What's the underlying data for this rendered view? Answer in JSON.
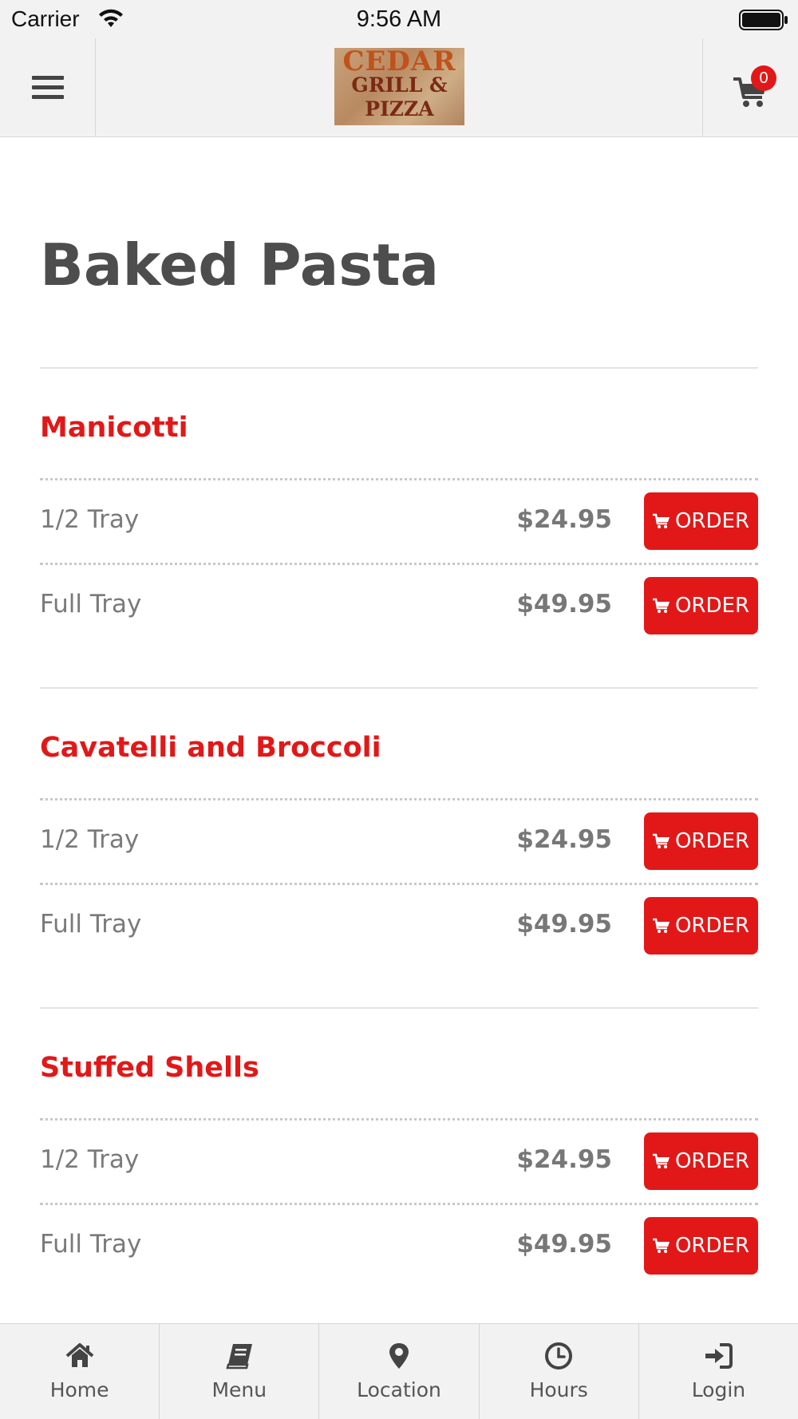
{
  "status_bar": {
    "carrier": "Carrier",
    "time": "9:56 AM"
  },
  "header": {
    "logo": {
      "line1": "CEDAR",
      "line2": "GRILL &",
      "line3": "PIZZA"
    },
    "cart_count": "0",
    "menu_icon": "hamburger-icon",
    "cart_icon": "shopping-cart-icon"
  },
  "page": {
    "title": "Baked Pasta"
  },
  "items": [
    {
      "name": "Manicotti",
      "options": [
        {
          "size": "1/2 Tray",
          "price": "$24.95",
          "button": "ORDER"
        },
        {
          "size": "Full Tray",
          "price": "$49.95",
          "button": "ORDER"
        }
      ]
    },
    {
      "name": "Cavatelli and Broccoli",
      "options": [
        {
          "size": "1/2 Tray",
          "price": "$24.95",
          "button": "ORDER"
        },
        {
          "size": "Full Tray",
          "price": "$49.95",
          "button": "ORDER"
        }
      ]
    },
    {
      "name": "Stuffed Shells",
      "options": [
        {
          "size": "1/2 Tray",
          "price": "$24.95",
          "button": "ORDER"
        },
        {
          "size": "Full Tray",
          "price": "$49.95",
          "button": "ORDER"
        }
      ]
    }
  ],
  "tabbar": [
    {
      "label": "Home",
      "icon": "home-icon"
    },
    {
      "label": "Menu",
      "icon": "book-icon"
    },
    {
      "label": "Location",
      "icon": "map-marker-icon"
    },
    {
      "label": "Hours",
      "icon": "clock-icon"
    },
    {
      "label": "Login",
      "icon": "sign-in-icon"
    }
  ],
  "colors": {
    "accent": "#e21818",
    "bar_background": "#f2f2f2",
    "title_text": "#4d4d4d"
  }
}
